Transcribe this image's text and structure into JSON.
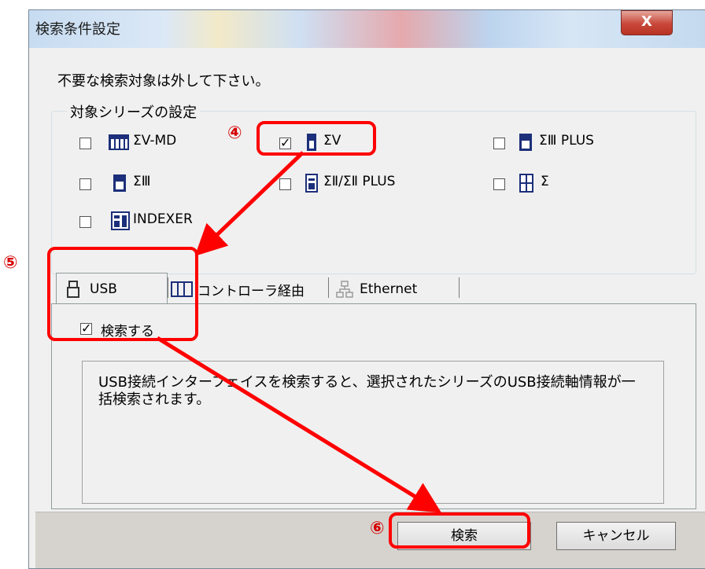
{
  "window": {
    "title": "検索条件設定",
    "close_glyph": "X"
  },
  "instruction": "不要な検索対象は外して下さい。",
  "group": {
    "legend": "対象シリーズの設定",
    "series": [
      {
        "label": "ΣV-MD",
        "checked": false
      },
      {
        "label": "ΣV",
        "checked": true
      },
      {
        "label": "ΣⅢ PLUS",
        "checked": false
      },
      {
        "label": "ΣⅢ",
        "checked": false
      },
      {
        "label": "ΣⅡ/ΣⅡ PLUS",
        "checked": false
      },
      {
        "label": "Σ",
        "checked": false
      },
      {
        "label": "INDEXER",
        "checked": false
      }
    ]
  },
  "tabs": [
    {
      "label": "USB",
      "icon": "usb-plug-icon",
      "active": true
    },
    {
      "label": "コントローラ経由",
      "icon": "controller-icon",
      "active": false
    },
    {
      "label": "Ethernet",
      "icon": "network-icon",
      "active": false
    }
  ],
  "usb_panel": {
    "search_label": "検索する",
    "search_checked": true,
    "description": "USB接続インターフェイスを検索すると、選択されたシリーズのUSB接続軸情報が一括検索されます。"
  },
  "buttons": {
    "search": "検索",
    "cancel": "キャンセル"
  },
  "annotations": {
    "step4": "④",
    "step5": "⑤",
    "step6": "⑥"
  },
  "colors": {
    "annotation": "#ff0000",
    "icon_blue": "#1c2f7a"
  }
}
